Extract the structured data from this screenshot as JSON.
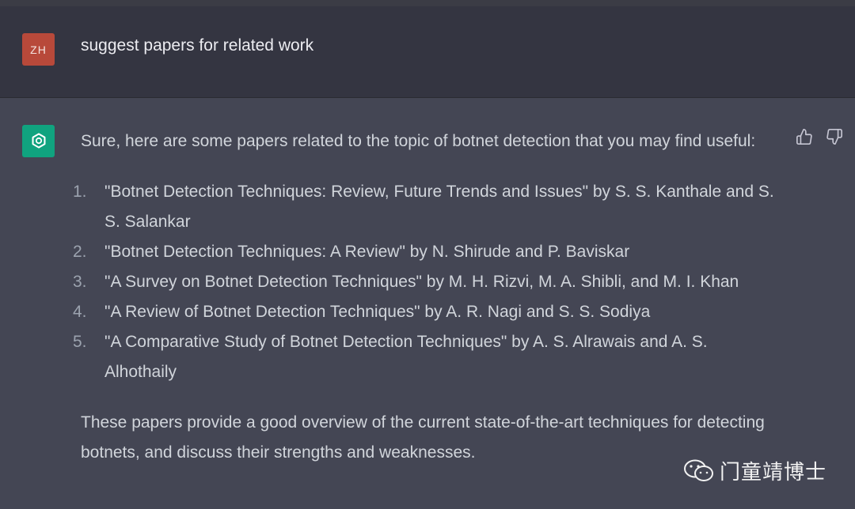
{
  "user_message": {
    "avatar_initials": "ZH",
    "text": "suggest papers for related work"
  },
  "assistant_message": {
    "avatar_icon": "openai-logo-icon",
    "intro": "Sure, here are some papers related to the topic of botnet detection that you may find useful:",
    "papers": [
      {
        "num": "1.",
        "text": "\"Botnet Detection Techniques: Review, Future Trends and Issues\" by S. S. Kanthale and S. S. Salankar"
      },
      {
        "num": "2.",
        "text": "\"Botnet Detection Techniques: A Review\" by N. Shirude and P. Baviskar"
      },
      {
        "num": "3.",
        "text": "\"A Survey on Botnet Detection Techniques\" by M. H. Rizvi, M. A. Shibli, and M. I. Khan"
      },
      {
        "num": "4.",
        "text": "\"A Review of Botnet Detection Techniques\" by A. R. Nagi and S. S. Sodiya"
      },
      {
        "num": "5.",
        "text": "\"A Comparative Study of Botnet Detection Techniques\" by A. S. Alrawais and A. S. Alhothaily"
      }
    ],
    "outro": "These papers provide a good overview of the current state-of-the-art techniques for detecting botnets, and discuss their strengths and weaknesses."
  },
  "feedback": {
    "thumbs_up_icon": "thumbs-up-icon",
    "thumbs_down_icon": "thumbs-down-icon"
  },
  "watermark": {
    "icon": "wechat-icon",
    "text": "门童靖博士"
  },
  "colors": {
    "user_bg": "#343541",
    "assistant_bg": "#444654",
    "user_avatar": "#b8493a",
    "bot_avatar": "#10a37f"
  }
}
